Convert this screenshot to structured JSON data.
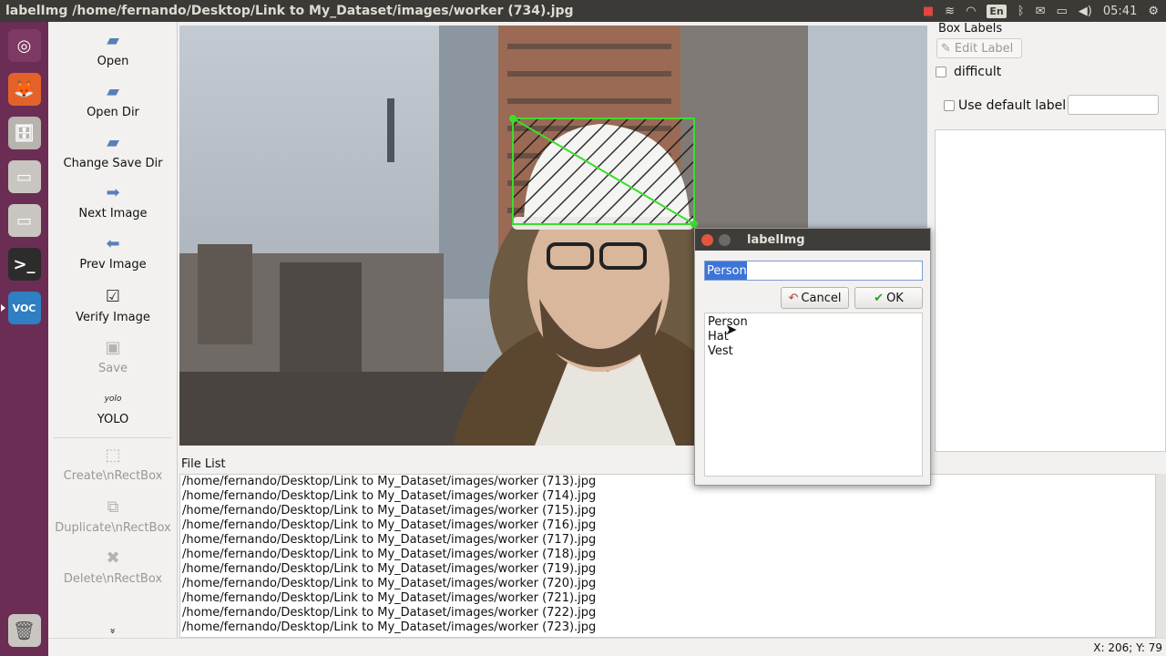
{
  "window": {
    "title": "labelImg /home/fernando/Desktop/Link to My_Dataset/images/worker (734).jpg"
  },
  "tray": {
    "keyboard": "En",
    "time": "05:41"
  },
  "launcher": {
    "items": [
      {
        "name": "ubuntu-dash-icon",
        "glyph": "◎",
        "bg": "#7d3a63"
      },
      {
        "name": "firefox-icon",
        "glyph": "🦊",
        "bg": "#e4622a"
      },
      {
        "name": "files-icon",
        "glyph": "🗄",
        "bg": "#b7b3ad"
      },
      {
        "name": "drive-icon-1",
        "glyph": "▭",
        "bg": "#c9c6c1"
      },
      {
        "name": "drive-icon-2",
        "glyph": "▭",
        "bg": "#c9c6c1"
      },
      {
        "name": "terminal-icon",
        "glyph": ">_",
        "bg": "#2c2c2c"
      },
      {
        "name": "voc-icon",
        "glyph": "VOC",
        "bg": "#2f7fc2"
      }
    ],
    "trash_glyph": "🗑"
  },
  "toolbar": {
    "open": "Open",
    "open_dir": "Open Dir",
    "change_save_dir": "Change Save Dir",
    "next_image": "Next Image",
    "prev_image": "Prev Image",
    "verify_image": "Verify Image",
    "save": "Save",
    "yolo_icon_text": "yolo",
    "yolo": "YOLO",
    "create_rectbox": "Create\\nRectBox",
    "duplicate_rectbox": "Duplicate\\nRectBox",
    "delete_rectbox": "Delete\\nRectBox",
    "more": "»"
  },
  "right_panel": {
    "box_labels": "Box Labels",
    "edit_label": "Edit Label",
    "difficult": "difficult",
    "use_default_label": "Use default label",
    "default_label_value": ""
  },
  "file_list": {
    "title": "File List",
    "rows": [
      "/home/fernando/Desktop/Link to My_Dataset/images/worker (713).jpg",
      "/home/fernando/Desktop/Link to My_Dataset/images/worker (714).jpg",
      "/home/fernando/Desktop/Link to My_Dataset/images/worker (715).jpg",
      "/home/fernando/Desktop/Link to My_Dataset/images/worker (716).jpg",
      "/home/fernando/Desktop/Link to My_Dataset/images/worker (717).jpg",
      "/home/fernando/Desktop/Link to My_Dataset/images/worker (718).jpg",
      "/home/fernando/Desktop/Link to My_Dataset/images/worker (719).jpg",
      "/home/fernando/Desktop/Link to My_Dataset/images/worker (720).jpg",
      "/home/fernando/Desktop/Link to My_Dataset/images/worker (721).jpg",
      "/home/fernando/Desktop/Link to My_Dataset/images/worker (722).jpg",
      "/home/fernando/Desktop/Link to My_Dataset/images/worker (723).jpg"
    ]
  },
  "status": {
    "coords": "X: 206; Y: 79"
  },
  "dialog": {
    "title": "labelImg",
    "input_value": "Person",
    "cancel": "Cancel",
    "ok": "OK",
    "labels": [
      "Person",
      "Hat",
      "Vest"
    ]
  },
  "colors": {
    "bbox": "#3ddc2e",
    "launcher": "#6b2d54",
    "titlebar": "#3b3a36"
  }
}
